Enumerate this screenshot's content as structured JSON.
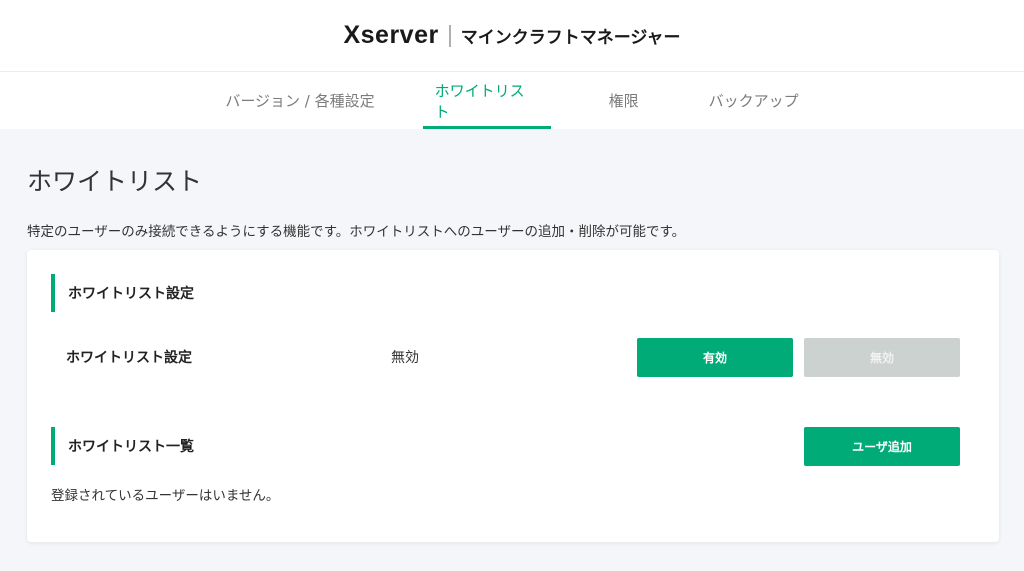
{
  "header": {
    "logo": "Xserver",
    "product": "マインクラフトマネージャー"
  },
  "tabs": [
    {
      "label": "バージョン / 各種設定"
    },
    {
      "label": "ホワイトリスト"
    },
    {
      "label": "権限"
    },
    {
      "label": "バックアップ"
    }
  ],
  "main": {
    "title": "ホワイトリスト",
    "description": "特定のユーザーのみ接続できるようにする機能です。ホワイトリストへのユーザーの追加・削除が可能です。"
  },
  "settings_section": {
    "heading": "ホワイトリスト設定",
    "row_label": "ホワイトリスト設定",
    "current_value": "無効",
    "enable_button": "有効",
    "disable_button": "無効"
  },
  "list_section": {
    "heading": "ホワイトリスト一覧",
    "add_user_button": "ユーザ追加",
    "empty_message": "登録されているユーザーはいません。"
  },
  "colors": {
    "accent": "#00ab77",
    "disabled_button": "#ccd2d0",
    "background": "#f4f6f9"
  }
}
